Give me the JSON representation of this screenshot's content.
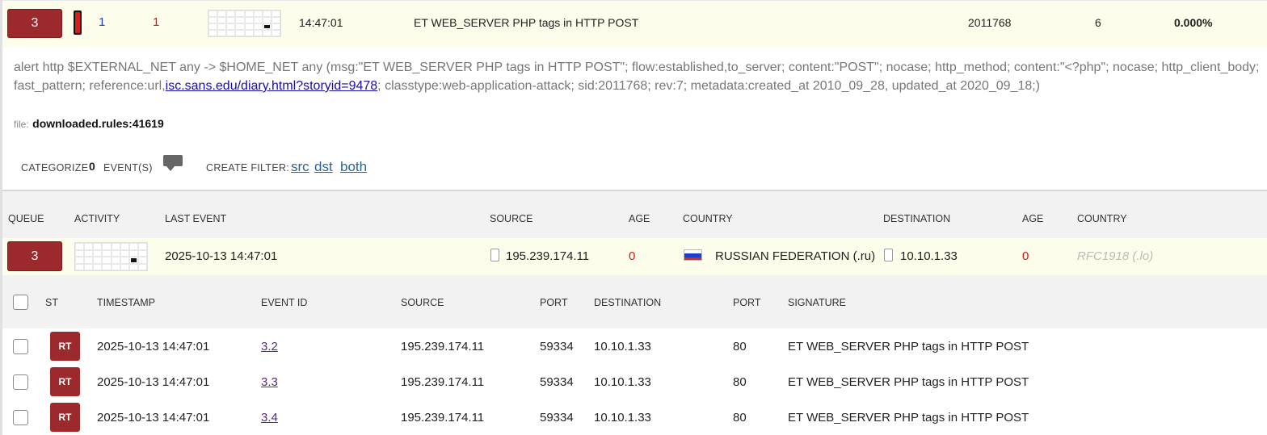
{
  "alert": {
    "queue": "3",
    "src_count": "1",
    "dst_count": "1",
    "last_time": "14:47:01",
    "signature": "ET WEB_SERVER PHP tags in HTTP POST",
    "sid": "2011768",
    "count": "6",
    "percent": "0.000%",
    "severity_color": "#d31e1e"
  },
  "rule": {
    "text_before": "alert http $EXTERNAL_NET any -> $HOME_NET any (msg:\"ET WEB_SERVER PHP tags in HTTP POST\"; flow:established,to_server; content:\"POST\"; nocase; http_method; content:\"<?php\"; nocase; http_client_body; fast_pattern; reference:url,",
    "link_host": "isc.sans.edu",
    "link_path": "/diary.html?storyid=9478",
    "text_after": "; classtype:web-application-attack; sid:2011768; rev:7; metadata:created_at 2010_09_28, updated_at 2020_09_18;)"
  },
  "file": {
    "label": "file:",
    "value": "downloaded.rules:41619"
  },
  "actions": {
    "categorize_label": "CATEGORIZE",
    "categorize_count": "0",
    "events_label": "EVENT(S)",
    "comment_icon": "comment-icon",
    "create_filter_label": "CREATE FILTER:",
    "filter_src": "src",
    "filter_dst": "dst",
    "filter_both": "both"
  },
  "summary_headers": {
    "queue": "QUEUE",
    "activity": "ACTIVITY",
    "last_event": "LAST EVENT",
    "source": "SOURCE",
    "age": "AGE",
    "country": "COUNTRY",
    "destination": "DESTINATION",
    "age2": "AGE",
    "country2": "COUNTRY"
  },
  "summary_row": {
    "queue": "3",
    "last_event": "2025-10-13 14:47:01",
    "source": "195.239.174.11",
    "src_age": "0",
    "src_country": "RUSSIAN FEDERATION (.ru)",
    "destination": "10.10.1.33",
    "dst_age": "0",
    "dst_country": "RFC1918 (.lo)"
  },
  "event_headers": {
    "st": "ST",
    "timestamp": "TIMESTAMP",
    "event_id": "EVENT ID",
    "source": "SOURCE",
    "port": "PORT",
    "destination": "DESTINATION",
    "port2": "PORT",
    "signature": "SIGNATURE"
  },
  "events": [
    {
      "st": "RT",
      "timestamp": "2025-10-13 14:47:01",
      "event_id": "3.2",
      "source": "195.239.174.11",
      "src_port": "59334",
      "destination": "10.10.1.33",
      "dst_port": "80",
      "signature": "ET WEB_SERVER PHP tags in HTTP POST"
    },
    {
      "st": "RT",
      "timestamp": "2025-10-13 14:47:01",
      "event_id": "3.3",
      "source": "195.239.174.11",
      "src_port": "59334",
      "destination": "10.10.1.33",
      "dst_port": "80",
      "signature": "ET WEB_SERVER PHP tags in HTTP POST"
    },
    {
      "st": "RT",
      "timestamp": "2025-10-13 14:47:01",
      "event_id": "3.4",
      "source": "195.239.174.11",
      "src_port": "59334",
      "destination": "10.10.1.33",
      "dst_port": "80",
      "signature": "ET WEB_SERVER PHP tags in HTTP POST"
    }
  ]
}
